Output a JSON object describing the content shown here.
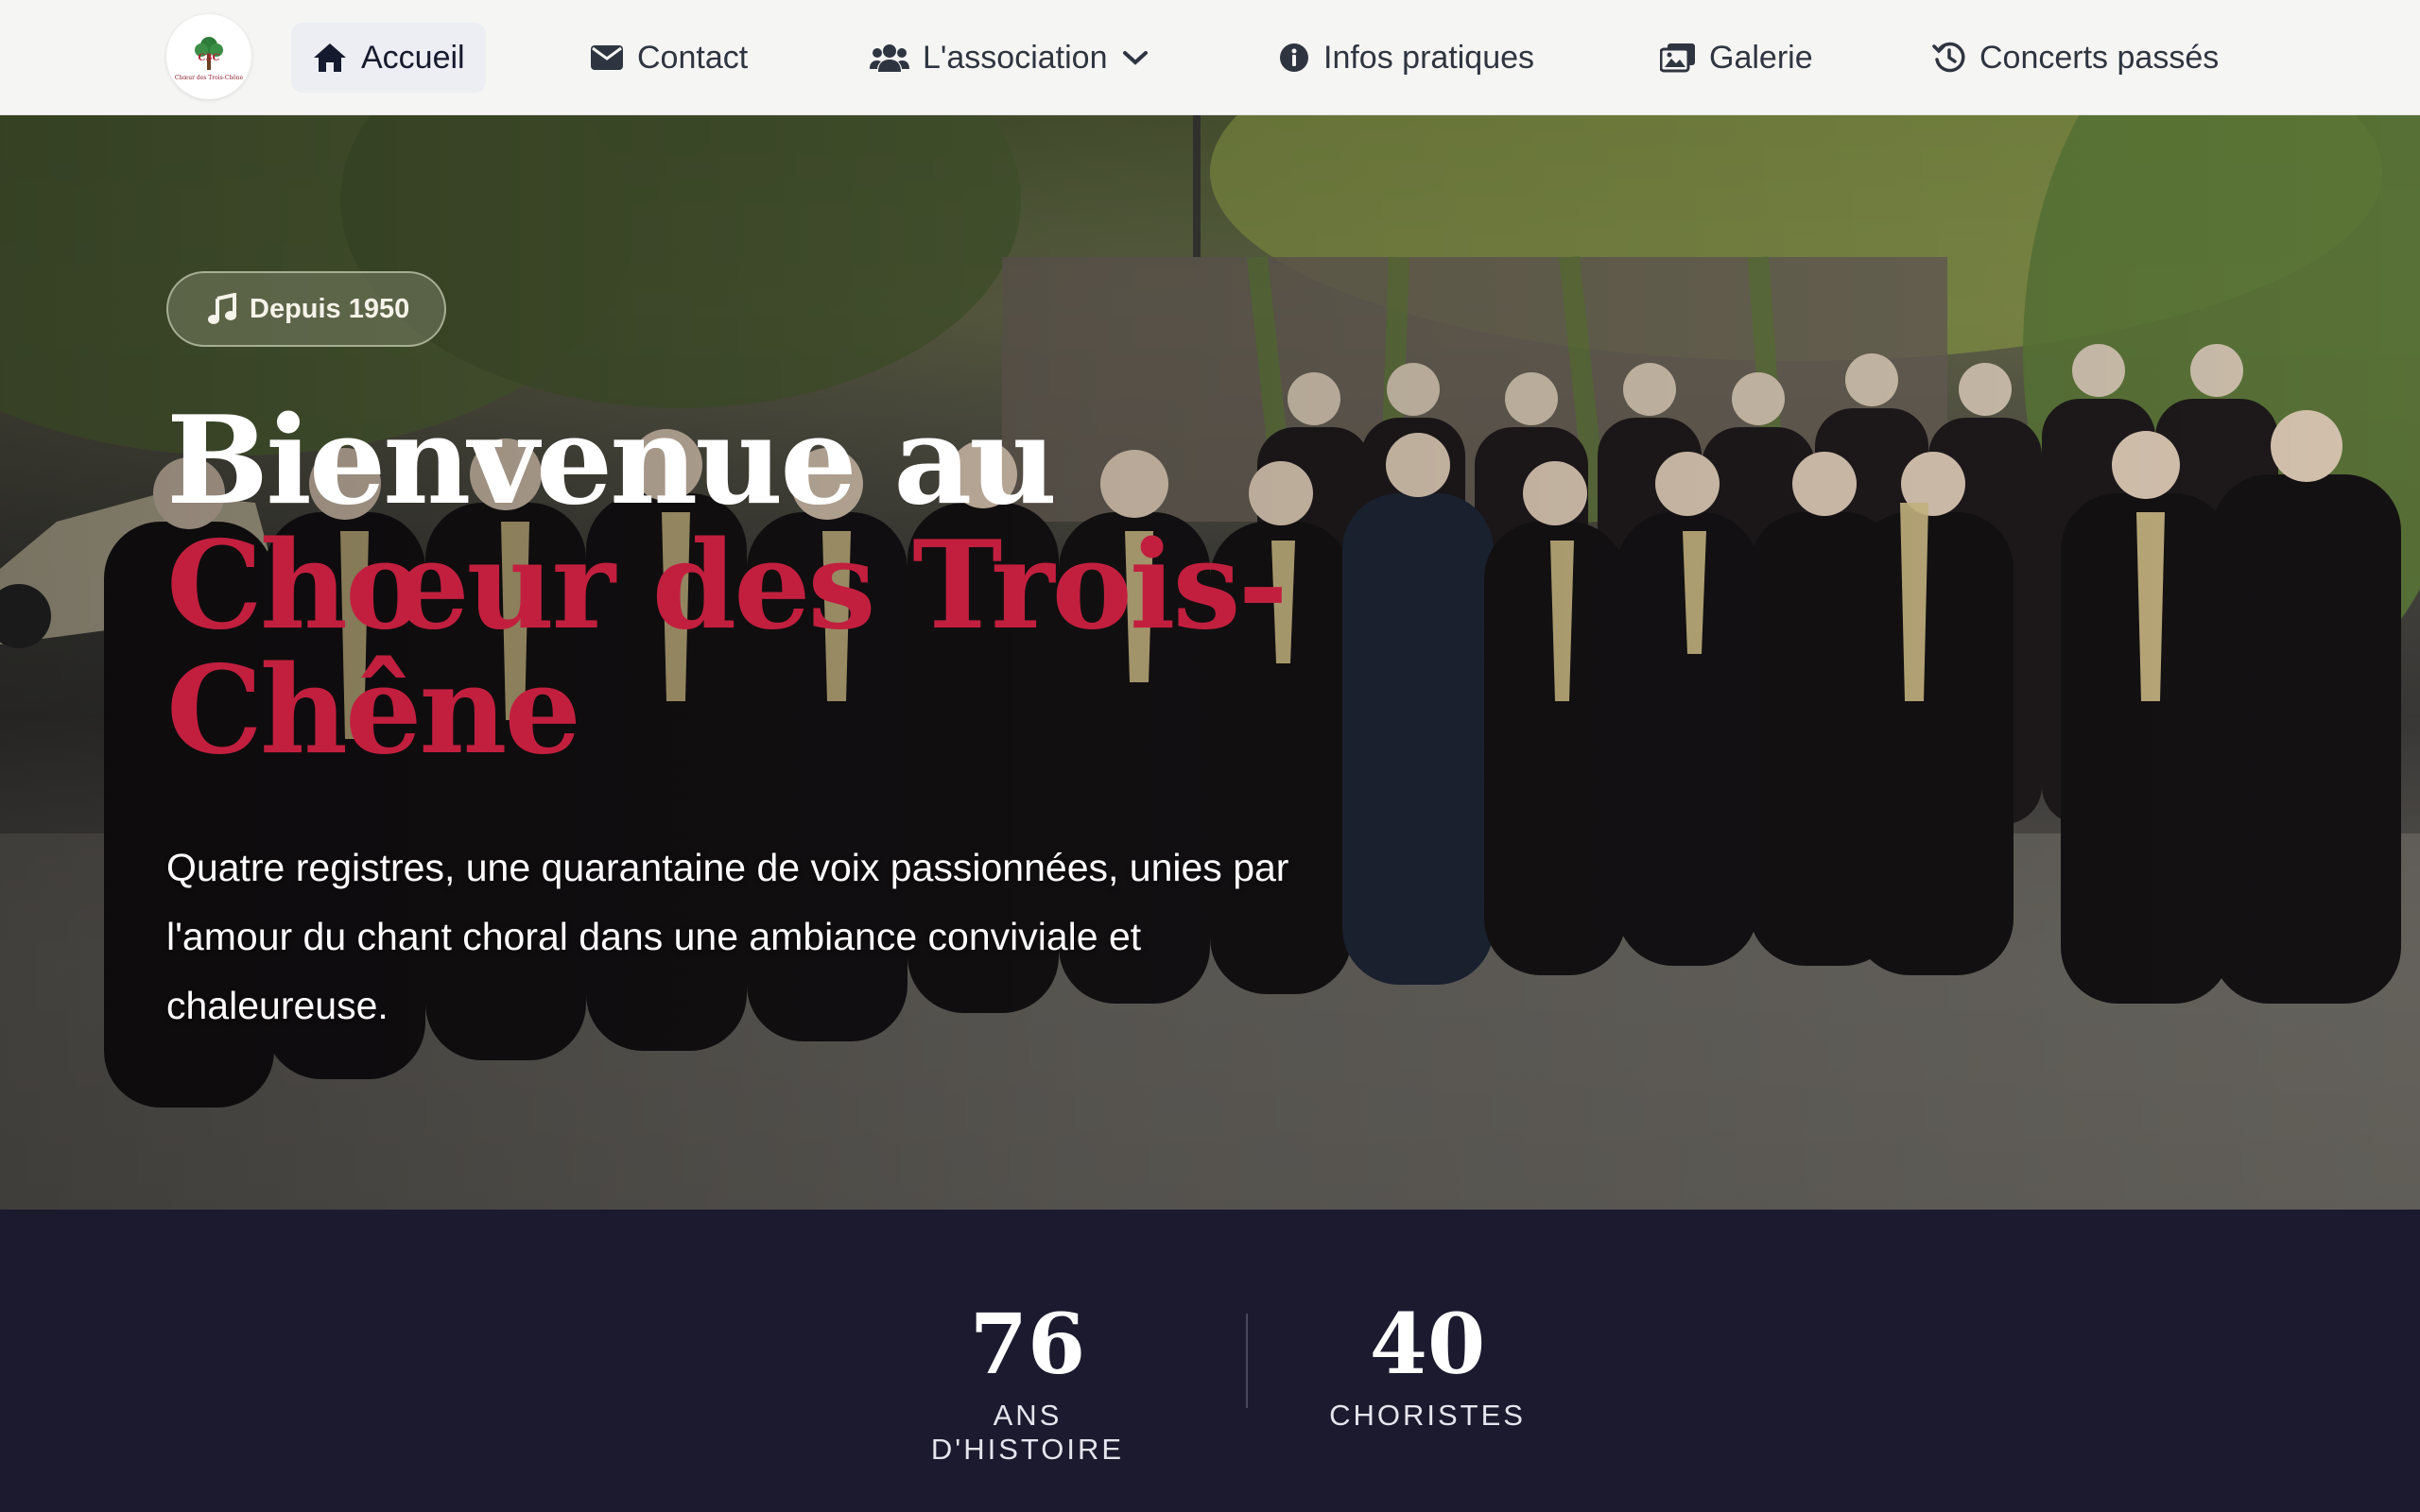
{
  "nav": {
    "logo_tiny_text": "Chœur des Trois-Chêne",
    "items": [
      {
        "label": "Accueil",
        "icon": "home-icon",
        "active": true
      },
      {
        "label": "Contact",
        "icon": "envelope-icon"
      },
      {
        "label": "L'association",
        "icon": "users-icon",
        "has_dropdown": true
      },
      {
        "label": "Infos pratiques",
        "icon": "info-circle-icon"
      },
      {
        "label": "Galerie",
        "icon": "images-icon"
      },
      {
        "label": "Concerts passés",
        "icon": "history-icon"
      }
    ]
  },
  "hero": {
    "badge": "Depuis 1950",
    "badge_icon": "music-note-icon",
    "title_part1": "Bienvenue au ",
    "title_accent": "Chœur des Trois-Chêne",
    "lead": "Quatre registres, une quarantaine de voix passionnées, unies par l'amour du chant choral dans une ambiance conviviale et chaleureuse."
  },
  "stats": [
    {
      "value": "76",
      "label": "ANS D'HISTOIRE"
    },
    {
      "value": "40",
      "label": "CHORISTES"
    }
  ],
  "colors": {
    "accent": "#c21f3f",
    "nav_background": "#f5f5f4",
    "stats_background": "#1b1a2e"
  }
}
